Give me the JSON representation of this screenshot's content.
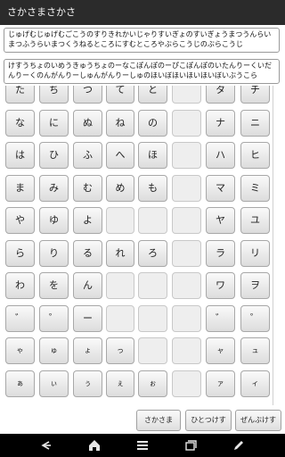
{
  "app": {
    "title": "さかさまさかさ"
  },
  "text_fields": {
    "input_text": "じゅげむじゅげむごこうのすりきれかいじゃりすいぎょのすいぎょうまつうんらいまつふうらいまつくうねるところにすむところやぶらこうじのぶらこうじ",
    "output_text": "けすうちょのいめうきゅうちょのーなこぽんぽのーぴこぽんぽのいたんりーくいだんりーくのんがんりーしゅんがんりーしゅのほいぼほいほいほいぼいぶうこら"
  },
  "keyboard": {
    "rows": [
      {
        "left": [
          "た",
          "ち",
          "つ",
          "て",
          "と",
          ""
        ],
        "right": [
          "タ",
          "チ"
        ]
      },
      {
        "left": [
          "な",
          "に",
          "ぬ",
          "ね",
          "の",
          ""
        ],
        "right": [
          "ナ",
          "ニ"
        ]
      },
      {
        "left": [
          "は",
          "ひ",
          "ふ",
          "へ",
          "ほ",
          ""
        ],
        "right": [
          "ハ",
          "ヒ"
        ]
      },
      {
        "left": [
          "ま",
          "み",
          "む",
          "め",
          "も",
          ""
        ],
        "right": [
          "マ",
          "ミ"
        ]
      },
      {
        "left": [
          "や",
          "ゆ",
          "よ",
          "",
          "",
          ""
        ],
        "right": [
          "ヤ",
          "ユ"
        ]
      },
      {
        "left": [
          "ら",
          "り",
          "る",
          "れ",
          "ろ",
          ""
        ],
        "right": [
          "ラ",
          "リ"
        ]
      },
      {
        "left": [
          "わ",
          "を",
          "ん",
          "",
          "",
          ""
        ],
        "right": [
          "ワ",
          "ヲ"
        ]
      },
      {
        "left": [
          "゛",
          "゜",
          "ー",
          "",
          "",
          ""
        ],
        "right": [
          "゛",
          "゜"
        ]
      },
      {
        "left": [
          "ゃ",
          "ゅ",
          "ょ",
          "っ",
          "",
          ""
        ],
        "right": [
          "ャ",
          "ュ"
        ]
      },
      {
        "left": [
          "ぁ",
          "ぃ",
          "ぅ",
          "ぇ",
          "ぉ",
          ""
        ],
        "right": [
          "ァ",
          "ィ"
        ]
      }
    ]
  },
  "function_buttons": {
    "sakasama": "さかさま",
    "hitotsukesu": "ひとつけす",
    "zenbukesu": "ぜんぶけす"
  },
  "navbar": {
    "icons": [
      "back-icon",
      "home-icon",
      "menu-icon",
      "recent-apps-icon",
      "edit-icon"
    ]
  }
}
